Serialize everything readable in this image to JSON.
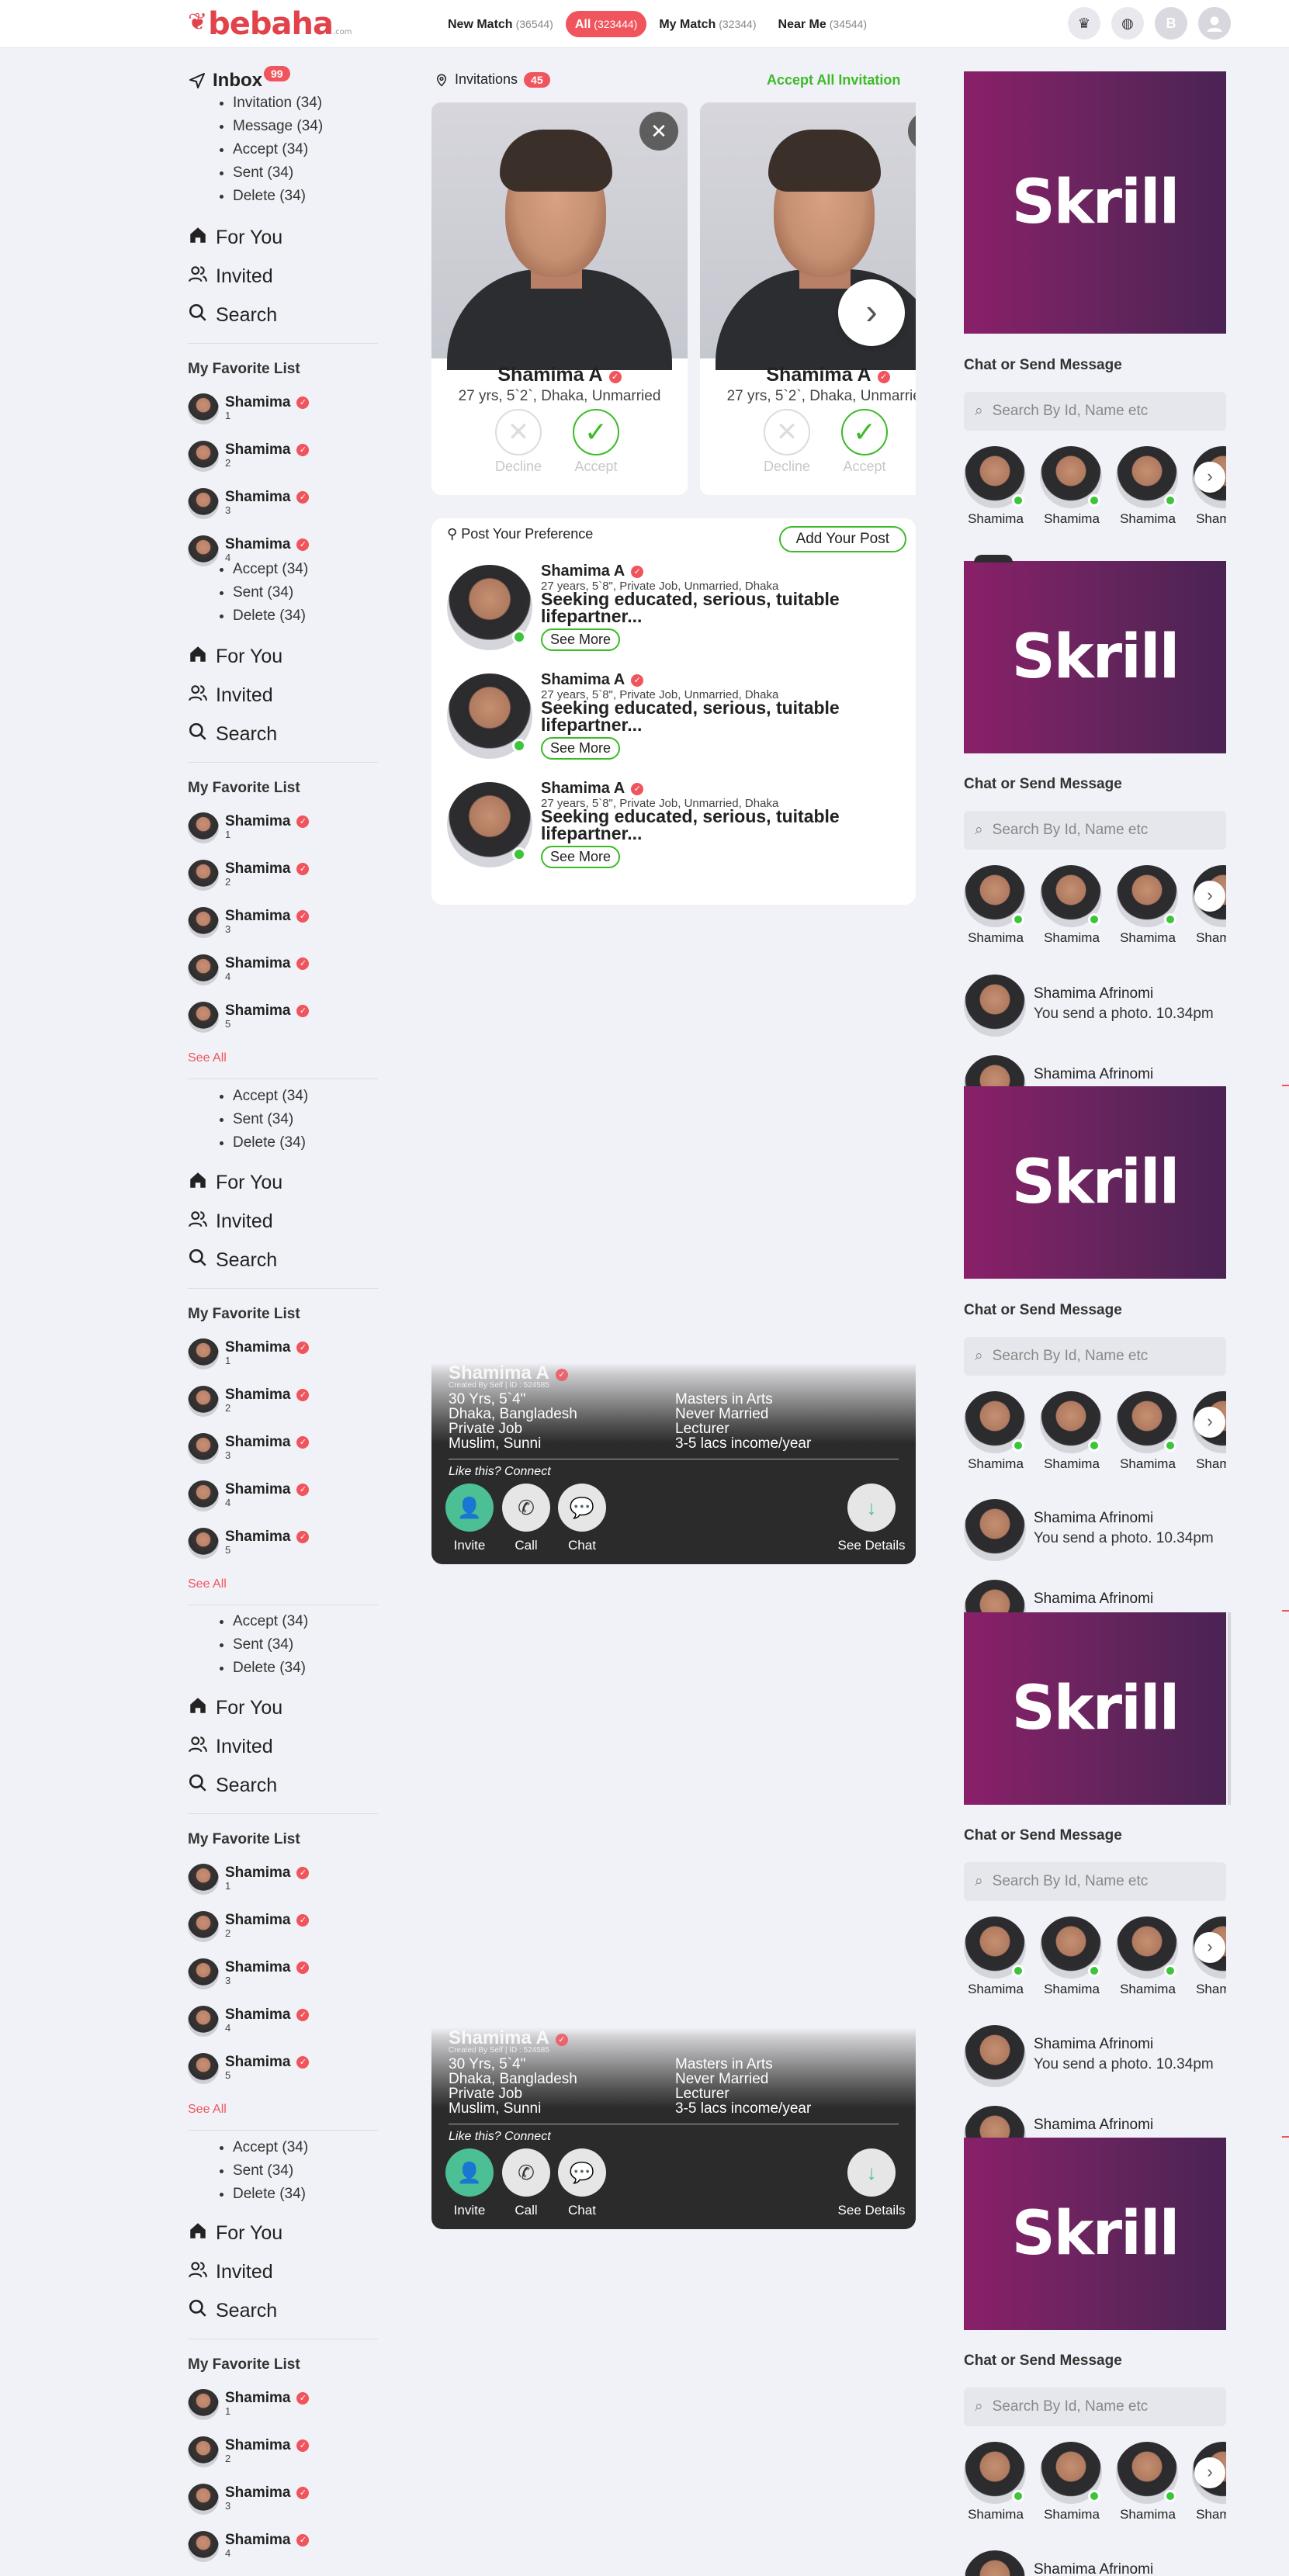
{
  "brand": {
    "logo": "bebaha",
    "logo_suffix": ".com"
  },
  "nav": {
    "tabs": [
      {
        "label": "New Match",
        "count": "(36544)"
      },
      {
        "label": "All",
        "count": "(323444)"
      },
      {
        "label": "My Match",
        "count": "(32344)"
      },
      {
        "label": "Near Me",
        "count": "(34544)"
      }
    ],
    "avatar_letter": "B"
  },
  "inbox": {
    "title": "Inbox",
    "badge": "99",
    "items": [
      "Invitation (34)",
      "Message (34)",
      "Accept (34)",
      "Sent (34)",
      "Delete (34)"
    ]
  },
  "sub_items": [
    "Accept (34)",
    "Sent (34)",
    "Delete (34)"
  ],
  "menu": {
    "for_you": "For You",
    "invited": "Invited",
    "search": "Search"
  },
  "favorites": {
    "title": "My Favorite List",
    "name": "Shamima",
    "nums": [
      "1",
      "2",
      "3",
      "4",
      "5"
    ],
    "see_all": "See All"
  },
  "invitations": {
    "title": "Invitations",
    "count": "45",
    "accept_all": "Accept All Invitation",
    "cards": [
      {
        "name": "Shamima A",
        "info": "27 yrs, 5`2`, Dhaka, Unmarried",
        "decline": "Decline",
        "accept": "Accept"
      },
      {
        "name": "Shamima A",
        "info": "27 yrs, 5`2`, Dhaka, Unmarried",
        "decline": "Decline",
        "accept": "Accept"
      }
    ]
  },
  "preference": {
    "title": "Post Your Preference",
    "add_post": "Add Your Post",
    "posts": [
      {
        "name": "Shamima A",
        "meta": "27 years, 5`8\", Private Job, Unmarried, Dhaka",
        "desc": "Seeking educated, serious, tuitable lifepartner...",
        "see_more": "See More"
      },
      {
        "name": "Shamima A",
        "meta": "27 years, 5`8\", Private Job, Unmarried, Dhaka",
        "desc": "Seeking educated, serious, tuitable lifepartner...",
        "see_more": "See More"
      },
      {
        "name": "Shamima A",
        "meta": "27 years, 5`8\", Private Job, Unmarried, Dhaka",
        "desc": "Seeking educated, serious, tuitable lifepartner...",
        "see_more": "See More"
      }
    ]
  },
  "profile_card": {
    "name": "Shamima A",
    "created": "Created By Self  |  ID : 524585",
    "left": [
      "30 Yrs, 5`4\"",
      "Dhaka, Bangladesh",
      "Private Job",
      "Muslim, Sunni"
    ],
    "right": [
      "Masters in Arts",
      "Never Married",
      "Lecturer",
      "3-5 lacs income/year"
    ],
    "like": "Like this? Connect",
    "invite": "Invite",
    "call": "Call",
    "chat": "Chat",
    "details": "See Details"
  },
  "ad": {
    "text": "Skrill"
  },
  "chat": {
    "title": "Chat or Send Message",
    "search_placeholder": "Search By Id, Name etc",
    "avatar_name": "Shamima",
    "message": {
      "name": "Shamima Afrinomi",
      "text": "You send a photo. 10.34pm"
    }
  }
}
